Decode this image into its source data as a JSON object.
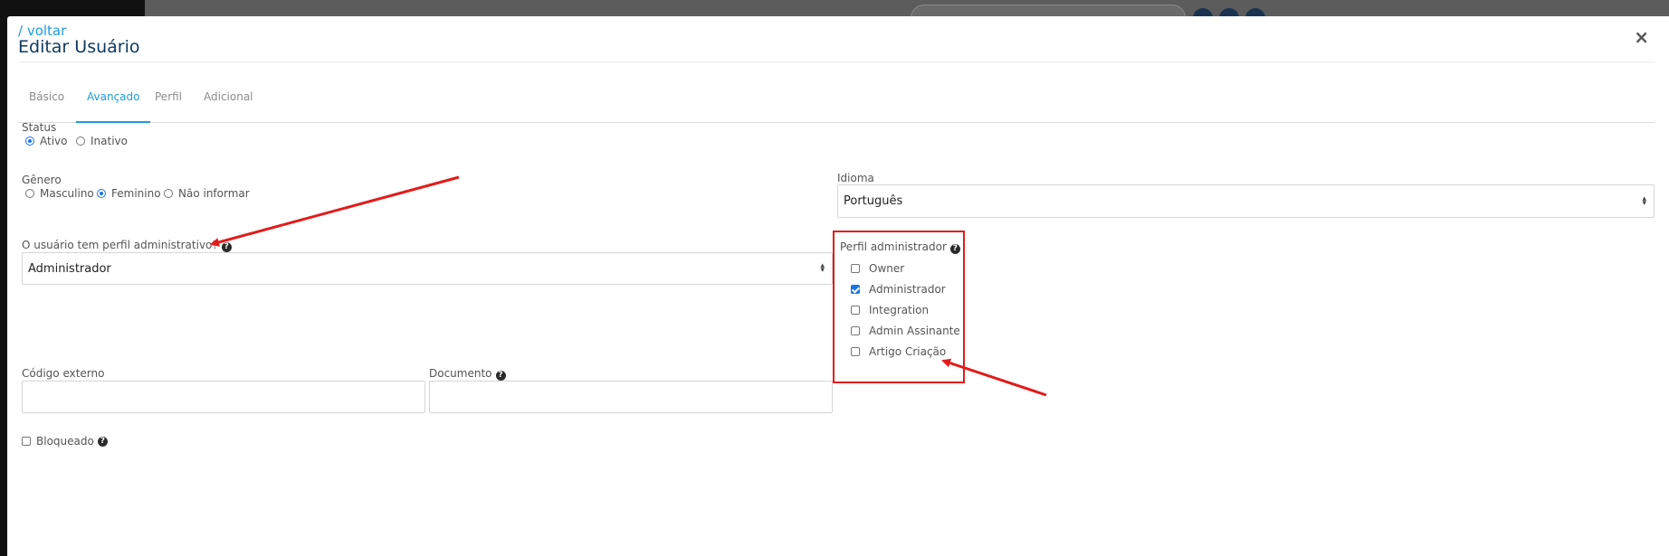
{
  "modal": {
    "back_link": "/ voltar",
    "title": "Editar Usuário",
    "close_symbol": "×"
  },
  "tabs": [
    {
      "label": "Básico",
      "active": false
    },
    {
      "label": "Avançado",
      "active": true
    },
    {
      "label": "Perfil",
      "active": false
    },
    {
      "label": "Adicional",
      "active": false
    }
  ],
  "status": {
    "label": "Status",
    "options": [
      {
        "label": "Ativo",
        "selected": true
      },
      {
        "label": "Inativo",
        "selected": false
      }
    ]
  },
  "genero": {
    "label": "Gênero",
    "options": [
      {
        "label": "Masculino",
        "selected": false
      },
      {
        "label": "Feminino",
        "selected": true
      },
      {
        "label": "Não informar",
        "selected": false
      }
    ]
  },
  "idioma": {
    "label": "Idioma",
    "value": "Português"
  },
  "perfil_administrativo": {
    "label": "O usuário tem perfil administrativo?",
    "value": "Administrador"
  },
  "perfil_administrador": {
    "label": "Perfil administrador",
    "options": [
      {
        "label": "Owner",
        "checked": false
      },
      {
        "label": "Administrador",
        "checked": true
      },
      {
        "label": "Integration",
        "checked": false
      },
      {
        "label": "Admin Assinante",
        "checked": false
      },
      {
        "label": "Artigo Criação",
        "checked": false
      }
    ]
  },
  "codigo_externo": {
    "label": "Código externo",
    "value": ""
  },
  "documento": {
    "label": "Documento",
    "value": ""
  },
  "bloqueado": {
    "label": "Bloqueado",
    "checked": false
  },
  "icons": {
    "help": "?"
  },
  "colors": {
    "accent": "#1e9be0",
    "title": "#0f3a63",
    "annotation": "#e31b1b",
    "radio_selected": "#1a73e8"
  }
}
